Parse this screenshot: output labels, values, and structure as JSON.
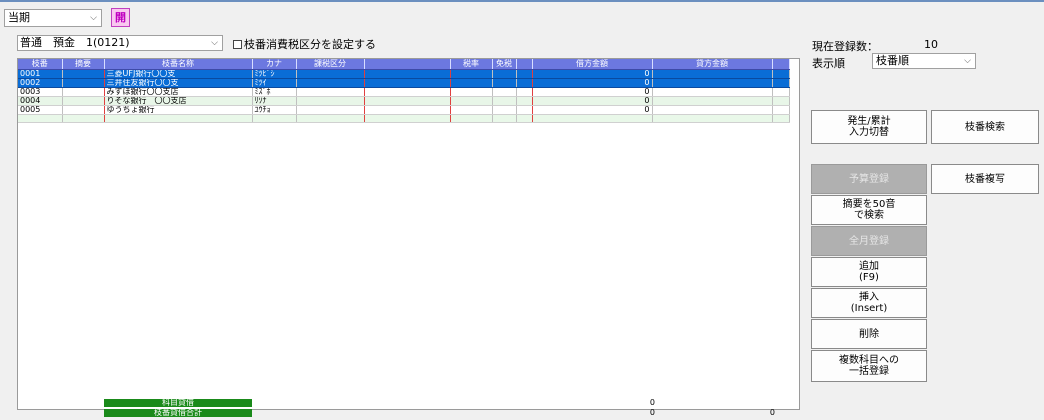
{
  "period": {
    "value": "当期"
  },
  "open_button": {
    "label": "開"
  },
  "account": {
    "value": "普通　預金　1(0121)"
  },
  "tax_checkbox": {
    "label": "枝番消費税区分を設定する",
    "checked": false
  },
  "grid": {
    "headers": [
      "枝番",
      "摘要",
      "枝番名称",
      "カナ",
      "課税区分",
      "",
      "税率",
      "免税",
      "",
      "借方金額",
      "貸方金額"
    ],
    "rows": [
      {
        "code": "0001",
        "name": "三菱UFJ銀行〇〇支",
        "kana": "ﾐﾂﾋﾞｼ",
        "debit": "0",
        "selected": true
      },
      {
        "code": "0002",
        "name": "三井住友銀行〇〇支",
        "kana": "ﾐﾂｲ",
        "debit": "0",
        "selected": true
      },
      {
        "code": "0003",
        "name": "みずほ銀行〇〇支店",
        "kana": "ﾐｽﾞﾎ",
        "debit": "0",
        "selected": false
      },
      {
        "code": "0004",
        "name": "りそな銀行　〇〇支店",
        "kana": "ﾘｿﾅ",
        "debit": "0",
        "selected": false
      },
      {
        "code": "0005",
        "name": "ゆうちょ銀行",
        "kana": "ﾕｳﾁｮ",
        "debit": "0",
        "selected": false
      }
    ]
  },
  "footer": {
    "subject_label": "科目貸借",
    "subject_debit": "0",
    "branch_label": "枝番貸借合計",
    "branch_debit": "0",
    "branch_credit": "0"
  },
  "right_panel": {
    "reg_count_label": "現在登録数：",
    "reg_count_value": "10",
    "order_label": "表示順",
    "order_value": "枝番順"
  },
  "buttons": {
    "toggle_input_1": "発生/累計",
    "toggle_input_2": "入力切替",
    "branch_search": "枝番検索",
    "budget": "予算登録",
    "branch_copy": "枝番複写",
    "kana_search_1": "摘要を50音",
    "kana_search_2": "で検索",
    "all_month": "全月登録",
    "add_1": "追加",
    "add_2": "(F9)",
    "insert_1": "挿入",
    "insert_2": "(Insert)",
    "delete": "削除",
    "multi_1": "複数科目への",
    "multi_2": "一括登録"
  }
}
